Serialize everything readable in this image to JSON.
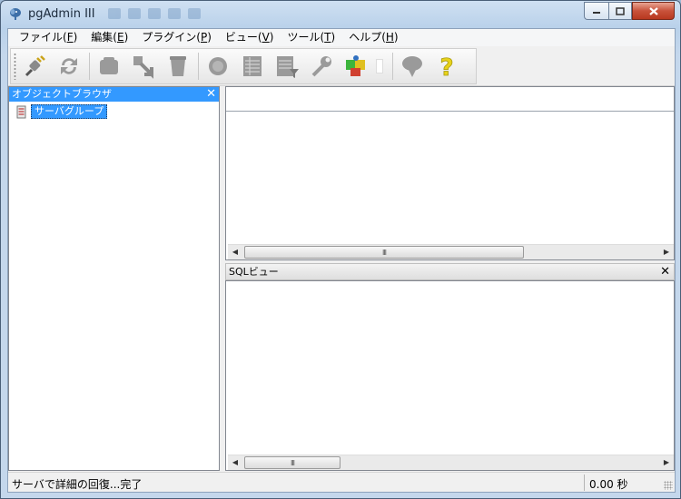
{
  "window": {
    "title": "pgAdmin III"
  },
  "menu": [
    {
      "label": "ファイル(",
      "key": "F",
      "close": ")"
    },
    {
      "label": "編集(",
      "key": "E",
      "close": ")"
    },
    {
      "label": "プラグイン(",
      "key": "P",
      "close": ")"
    },
    {
      "label": "ビュー(",
      "key": "V",
      "close": ")"
    },
    {
      "label": "ツール(",
      "key": "T",
      "close": ")"
    },
    {
      "label": "ヘルプ(",
      "key": "H",
      "close": ")"
    }
  ],
  "toolbar": {
    "buttons": [
      "connect-icon",
      "refresh-icon",
      "properties-icon",
      "create-icon",
      "drop-icon",
      "sql-icon",
      "view-data-icon",
      "filtered-data-icon",
      "maintenance-icon",
      "plugins-icon",
      "hint-icon",
      "help-icon"
    ]
  },
  "object_browser": {
    "title": "オブジェクトブラウザ",
    "close": "✕",
    "tree": [
      {
        "label": "サーバグループ",
        "selected": true
      }
    ]
  },
  "scrollbar": {
    "left_arrow": "◀",
    "right_arrow": "▶",
    "thumb_grip": "III"
  },
  "sql_pane": {
    "title": "SQLビュー",
    "close": "✕"
  },
  "statusbar": {
    "message": "サーバで詳細の回復...完了",
    "time": "0.00 秒"
  },
  "colors": {
    "selection": "#3399ff",
    "titlebar": "#c4d7ec",
    "close_button": "#c8523b"
  }
}
